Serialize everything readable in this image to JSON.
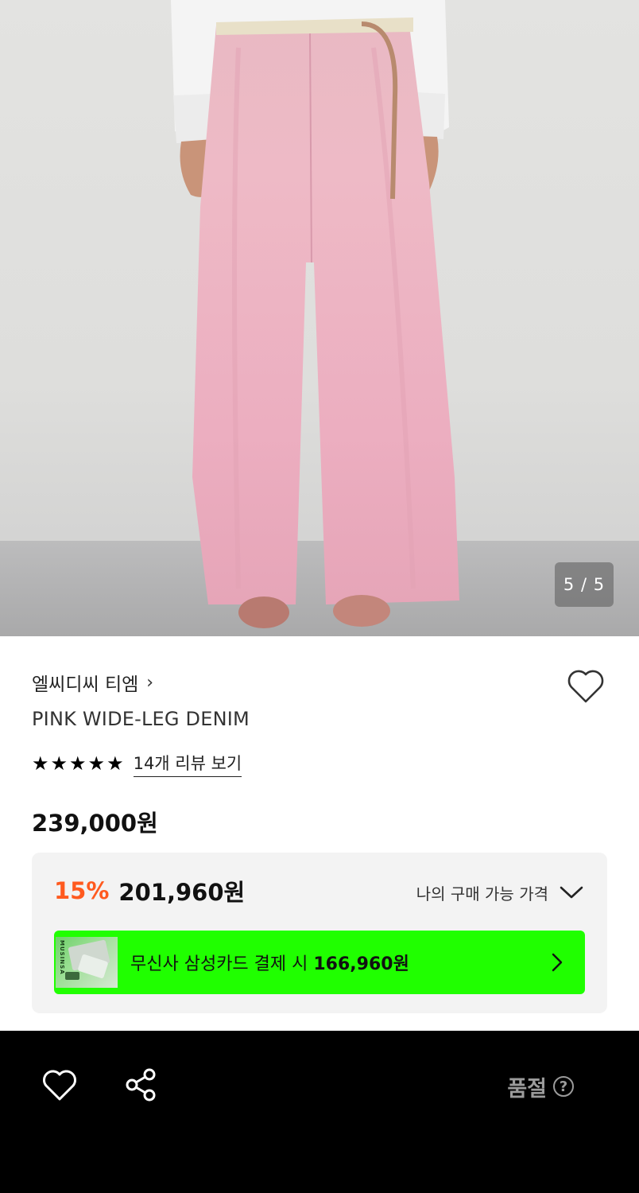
{
  "gallery": {
    "counter": "5 / 5",
    "current": 5,
    "total": 5,
    "image_alt": "pink-wide-leg-denim-photo"
  },
  "product": {
    "brand": "엘씨디씨 티엠",
    "brand_chevron": "›",
    "name": "PINK WIDE-LEG DENIM",
    "rating": 5,
    "review_link": "14개 리뷰 보기",
    "price_original": "239,000원",
    "wishlisted": false
  },
  "price_box": {
    "discount_pct": "15%",
    "discount_price": "201,960원",
    "my_price_label": "나의 구매 가능 가격",
    "card_banner_prefix": "무신사 삼성카드 결제 시 ",
    "card_banner_price": "166,960원",
    "card_thumb_label": "MUSINSA",
    "banner_color": "#20ff00",
    "discount_color": "#ff5a1f"
  },
  "bottom_bar": {
    "soldout_label": "품절",
    "help_symbol": "?",
    "icons": [
      "heart-icon",
      "share-icon"
    ]
  }
}
